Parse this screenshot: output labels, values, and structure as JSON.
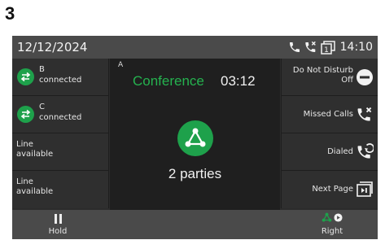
{
  "step_number": "3",
  "status_bar": {
    "date": "12/12/2024",
    "time": "14:10",
    "icons": [
      "phone-icon",
      "missed-call-icon",
      "voicemail-indicator-icon"
    ],
    "voicemail_count": "1"
  },
  "left_keys": [
    {
      "type": "party",
      "name": "B",
      "state": "connected",
      "icon": "transfer-icon"
    },
    {
      "type": "party",
      "name": "C",
      "state": "connected",
      "icon": "transfer-icon"
    },
    {
      "type": "line",
      "line1": "Line",
      "line2": "available"
    },
    {
      "type": "line",
      "line1": "Line",
      "line2": "available"
    }
  ],
  "right_keys": [
    {
      "label1": "Do Not Disturb",
      "label2": "Off",
      "icon": "dnd-icon"
    },
    {
      "label1": "Missed Calls",
      "icon": "missed-calls-icon"
    },
    {
      "label1": "Dialed",
      "icon": "dialed-calls-icon"
    },
    {
      "label1": "Next Page",
      "icon": "next-page-icon"
    }
  ],
  "call": {
    "line_label": "A",
    "title": "Conference",
    "duration": "03:12",
    "parties": "2 parties",
    "icon": "conference-icon"
  },
  "softkeys": {
    "left_label": "Hold",
    "right_label": "Right"
  },
  "colors": {
    "accent_green": "#1ea14b",
    "conference_text": "#25b24f",
    "bar_gray": "#4a4a4a",
    "background_dark": "#2c2c2c"
  }
}
